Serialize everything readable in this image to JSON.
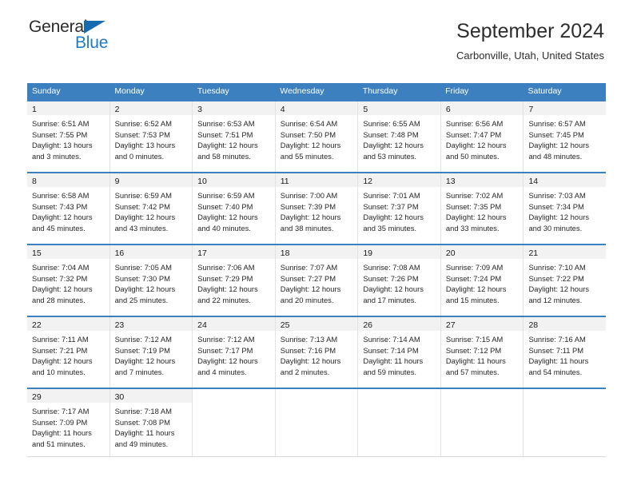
{
  "brand": {
    "name_top": "General",
    "name_bottom": "Blue",
    "triangle_color": "#1769b0",
    "blue_color": "#1f7ac4"
  },
  "header": {
    "title": "September 2024",
    "subtitle": "Carbonville, Utah, United States"
  },
  "theme": {
    "header_bg": "#3c80c0",
    "header_text": "#ffffff",
    "daynum_band_bg": "#f2f2f2",
    "cell_border": "#e2e2e2"
  },
  "weekdays": [
    "Sunday",
    "Monday",
    "Tuesday",
    "Wednesday",
    "Thursday",
    "Friday",
    "Saturday"
  ],
  "weeks": [
    [
      {
        "day": "1",
        "sunrise": "Sunrise: 6:51 AM",
        "sunset": "Sunset: 7:55 PM",
        "daylight1": "Daylight: 13 hours",
        "daylight2": "and 3 minutes."
      },
      {
        "day": "2",
        "sunrise": "Sunrise: 6:52 AM",
        "sunset": "Sunset: 7:53 PM",
        "daylight1": "Daylight: 13 hours",
        "daylight2": "and 0 minutes."
      },
      {
        "day": "3",
        "sunrise": "Sunrise: 6:53 AM",
        "sunset": "Sunset: 7:51 PM",
        "daylight1": "Daylight: 12 hours",
        "daylight2": "and 58 minutes."
      },
      {
        "day": "4",
        "sunrise": "Sunrise: 6:54 AM",
        "sunset": "Sunset: 7:50 PM",
        "daylight1": "Daylight: 12 hours",
        "daylight2": "and 55 minutes."
      },
      {
        "day": "5",
        "sunrise": "Sunrise: 6:55 AM",
        "sunset": "Sunset: 7:48 PM",
        "daylight1": "Daylight: 12 hours",
        "daylight2": "and 53 minutes."
      },
      {
        "day": "6",
        "sunrise": "Sunrise: 6:56 AM",
        "sunset": "Sunset: 7:47 PM",
        "daylight1": "Daylight: 12 hours",
        "daylight2": "and 50 minutes."
      },
      {
        "day": "7",
        "sunrise": "Sunrise: 6:57 AM",
        "sunset": "Sunset: 7:45 PM",
        "daylight1": "Daylight: 12 hours",
        "daylight2": "and 48 minutes."
      }
    ],
    [
      {
        "day": "8",
        "sunrise": "Sunrise: 6:58 AM",
        "sunset": "Sunset: 7:43 PM",
        "daylight1": "Daylight: 12 hours",
        "daylight2": "and 45 minutes."
      },
      {
        "day": "9",
        "sunrise": "Sunrise: 6:59 AM",
        "sunset": "Sunset: 7:42 PM",
        "daylight1": "Daylight: 12 hours",
        "daylight2": "and 43 minutes."
      },
      {
        "day": "10",
        "sunrise": "Sunrise: 6:59 AM",
        "sunset": "Sunset: 7:40 PM",
        "daylight1": "Daylight: 12 hours",
        "daylight2": "and 40 minutes."
      },
      {
        "day": "11",
        "sunrise": "Sunrise: 7:00 AM",
        "sunset": "Sunset: 7:39 PM",
        "daylight1": "Daylight: 12 hours",
        "daylight2": "and 38 minutes."
      },
      {
        "day": "12",
        "sunrise": "Sunrise: 7:01 AM",
        "sunset": "Sunset: 7:37 PM",
        "daylight1": "Daylight: 12 hours",
        "daylight2": "and 35 minutes."
      },
      {
        "day": "13",
        "sunrise": "Sunrise: 7:02 AM",
        "sunset": "Sunset: 7:35 PM",
        "daylight1": "Daylight: 12 hours",
        "daylight2": "and 33 minutes."
      },
      {
        "day": "14",
        "sunrise": "Sunrise: 7:03 AM",
        "sunset": "Sunset: 7:34 PM",
        "daylight1": "Daylight: 12 hours",
        "daylight2": "and 30 minutes."
      }
    ],
    [
      {
        "day": "15",
        "sunrise": "Sunrise: 7:04 AM",
        "sunset": "Sunset: 7:32 PM",
        "daylight1": "Daylight: 12 hours",
        "daylight2": "and 28 minutes."
      },
      {
        "day": "16",
        "sunrise": "Sunrise: 7:05 AM",
        "sunset": "Sunset: 7:30 PM",
        "daylight1": "Daylight: 12 hours",
        "daylight2": "and 25 minutes."
      },
      {
        "day": "17",
        "sunrise": "Sunrise: 7:06 AM",
        "sunset": "Sunset: 7:29 PM",
        "daylight1": "Daylight: 12 hours",
        "daylight2": "and 22 minutes."
      },
      {
        "day": "18",
        "sunrise": "Sunrise: 7:07 AM",
        "sunset": "Sunset: 7:27 PM",
        "daylight1": "Daylight: 12 hours",
        "daylight2": "and 20 minutes."
      },
      {
        "day": "19",
        "sunrise": "Sunrise: 7:08 AM",
        "sunset": "Sunset: 7:26 PM",
        "daylight1": "Daylight: 12 hours",
        "daylight2": "and 17 minutes."
      },
      {
        "day": "20",
        "sunrise": "Sunrise: 7:09 AM",
        "sunset": "Sunset: 7:24 PM",
        "daylight1": "Daylight: 12 hours",
        "daylight2": "and 15 minutes."
      },
      {
        "day": "21",
        "sunrise": "Sunrise: 7:10 AM",
        "sunset": "Sunset: 7:22 PM",
        "daylight1": "Daylight: 12 hours",
        "daylight2": "and 12 minutes."
      }
    ],
    [
      {
        "day": "22",
        "sunrise": "Sunrise: 7:11 AM",
        "sunset": "Sunset: 7:21 PM",
        "daylight1": "Daylight: 12 hours",
        "daylight2": "and 10 minutes."
      },
      {
        "day": "23",
        "sunrise": "Sunrise: 7:12 AM",
        "sunset": "Sunset: 7:19 PM",
        "daylight1": "Daylight: 12 hours",
        "daylight2": "and 7 minutes."
      },
      {
        "day": "24",
        "sunrise": "Sunrise: 7:12 AM",
        "sunset": "Sunset: 7:17 PM",
        "daylight1": "Daylight: 12 hours",
        "daylight2": "and 4 minutes."
      },
      {
        "day": "25",
        "sunrise": "Sunrise: 7:13 AM",
        "sunset": "Sunset: 7:16 PM",
        "daylight1": "Daylight: 12 hours",
        "daylight2": "and 2 minutes."
      },
      {
        "day": "26",
        "sunrise": "Sunrise: 7:14 AM",
        "sunset": "Sunset: 7:14 PM",
        "daylight1": "Daylight: 11 hours",
        "daylight2": "and 59 minutes."
      },
      {
        "day": "27",
        "sunrise": "Sunrise: 7:15 AM",
        "sunset": "Sunset: 7:12 PM",
        "daylight1": "Daylight: 11 hours",
        "daylight2": "and 57 minutes."
      },
      {
        "day": "28",
        "sunrise": "Sunrise: 7:16 AM",
        "sunset": "Sunset: 7:11 PM",
        "daylight1": "Daylight: 11 hours",
        "daylight2": "and 54 minutes."
      }
    ],
    [
      {
        "day": "29",
        "sunrise": "Sunrise: 7:17 AM",
        "sunset": "Sunset: 7:09 PM",
        "daylight1": "Daylight: 11 hours",
        "daylight2": "and 51 minutes."
      },
      {
        "day": "30",
        "sunrise": "Sunrise: 7:18 AM",
        "sunset": "Sunset: 7:08 PM",
        "daylight1": "Daylight: 11 hours",
        "daylight2": "and 49 minutes."
      },
      {
        "day": "",
        "sunrise": "",
        "sunset": "",
        "daylight1": "",
        "daylight2": ""
      },
      {
        "day": "",
        "sunrise": "",
        "sunset": "",
        "daylight1": "",
        "daylight2": ""
      },
      {
        "day": "",
        "sunrise": "",
        "sunset": "",
        "daylight1": "",
        "daylight2": ""
      },
      {
        "day": "",
        "sunrise": "",
        "sunset": "",
        "daylight1": "",
        "daylight2": ""
      },
      {
        "day": "",
        "sunrise": "",
        "sunset": "",
        "daylight1": "",
        "daylight2": ""
      }
    ]
  ]
}
